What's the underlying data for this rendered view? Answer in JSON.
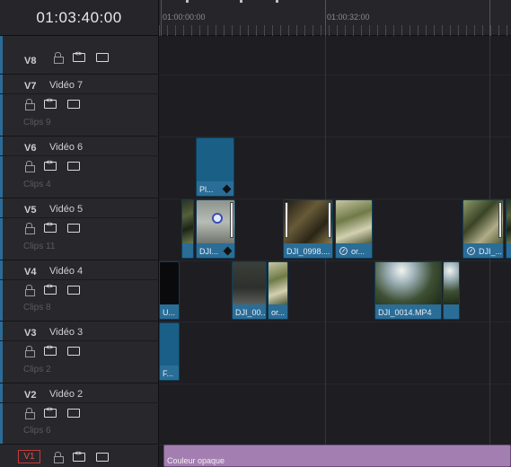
{
  "timecode": "01:03:40:00",
  "ruler": {
    "labels": [
      "01:00:00:00",
      "01:00:32:00"
    ]
  },
  "tracks": [
    {
      "id": "V8",
      "label": "",
      "clips": ""
    },
    {
      "id": "V7",
      "label": "Vidéo 7",
      "clips": "Clips 9"
    },
    {
      "id": "V6",
      "label": "Vidéo 6",
      "clips": "Clips 4"
    },
    {
      "id": "V5",
      "label": "Vidéo 5",
      "clips": "Clips 11"
    },
    {
      "id": "V4",
      "label": "Vidéo 4",
      "clips": "Clips 8"
    },
    {
      "id": "V3",
      "label": "Vidéo 3",
      "clips": "Clips 2"
    },
    {
      "id": "V2",
      "label": "Vidéo 2",
      "clips": "Clips 6"
    },
    {
      "id": "V1",
      "label": "",
      "clips": ""
    }
  ],
  "clips": {
    "v6_pl": "Pl...",
    "v5_dji_a": "DJI...",
    "v5_dji_0998": "DJI_0998....",
    "v5_or_a": "or...",
    "v5_dji_b": "DJI_...",
    "v4_u": "U...",
    "v4_dji_a": "DJI_00...",
    "v4_or": "or...",
    "v4_dji_0014": "DJI_0014.MP4",
    "v3_f": "F...",
    "v1_solid": "Couleur opaque"
  },
  "colors": {
    "video_clip": "#1a5f86",
    "solid_clip": "#a37fb1",
    "selected_track_outline": "#c43c3c"
  },
  "icons": [
    "lock-icon",
    "auto-select-icon",
    "monitor-icon",
    "speed-change-icon",
    "keyframe-icon"
  ]
}
